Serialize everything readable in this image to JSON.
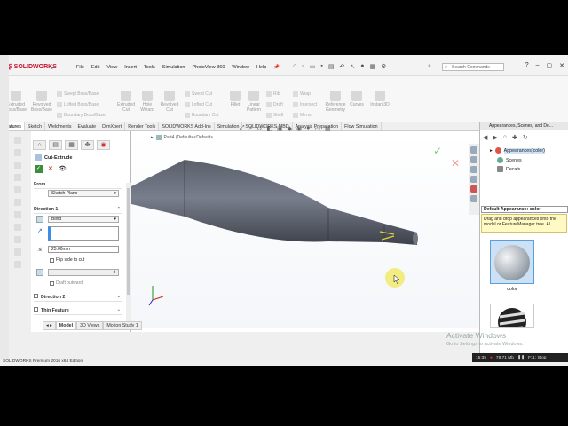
{
  "app": {
    "logo_text": "SOLIDWORKS",
    "status_text": "SOLIDWORKS Premium 2016 x64 Edition"
  },
  "menu": [
    "File",
    "Edit",
    "View",
    "Insert",
    "Tools",
    "Simulation",
    "PhotoView 360",
    "Window",
    "Help"
  ],
  "search": {
    "placeholder": "Search Commands"
  },
  "commands": {
    "extruded_boss": "Extruded Boss/Base",
    "revolved_boss": "Revolved Boss/Base",
    "swept_boss": "Swept Boss/Base",
    "lofted_boss": "Lofted Boss/Base",
    "boundary_boss": "Boundary Boss/Base",
    "extruded_cut": "Extruded Cut",
    "hole_wizard": "Hole Wizard",
    "revolved_cut": "Revolved Cut",
    "swept_cut": "Swept Cut",
    "lofted_cut": "Lofted Cut",
    "boundary_cut": "Boundary Cut",
    "fillet": "Fillet",
    "linear_pattern": "Linear Pattern",
    "rib": "Rib",
    "draft": "Draft",
    "shell": "Shell",
    "wrap": "Wrap",
    "intersect": "Intersect",
    "mirror": "Mirror",
    "reference_geometry": "Reference Geometry",
    "curves": "Curves",
    "instant3d": "Instant3D"
  },
  "tabs": [
    "Features",
    "Sketch",
    "Weldments",
    "Evaluate",
    "DimXpert",
    "Render Tools",
    "SOLIDWORKS Add-Ins",
    "Simulation",
    "SOLIDWORKS MBD",
    "Analysis Preparation",
    "Flow Simulation"
  ],
  "feature": {
    "title": "Cut-Extrude",
    "from_label": "From",
    "from_value": "Sketch Plane",
    "direction1_label": "Direction 1",
    "end_condition": "Blind",
    "depth": "25.00mm",
    "flip_side": "Flip side to cut",
    "draft_outward": "Draft outward",
    "direction2_label": "Direction 2",
    "thin_feature_label": "Thin Feature"
  },
  "viewport": {
    "tree_label": "Part4 (Default<<Default>..."
  },
  "bottom_tabs": [
    "Model",
    "3D Views",
    "Motion Study 1"
  ],
  "taskpane": {
    "title": "Appearances, Scenes, and De...",
    "items": [
      "Appearances(color)",
      "Scenes",
      "Decals"
    ],
    "tooltip_title": "Default Appearance: color",
    "tooltip_body": "Drag and drop appearances onto the model or FeatureManager tree. Al...",
    "swatch_label": "color"
  },
  "watermark": {
    "line1": "Activate Windows",
    "line2": "Go to Settings to activate Windows."
  },
  "taskbar": {
    "time": "15:35",
    "memory": "78.71 Mb",
    "fps": "F11: Stop"
  }
}
